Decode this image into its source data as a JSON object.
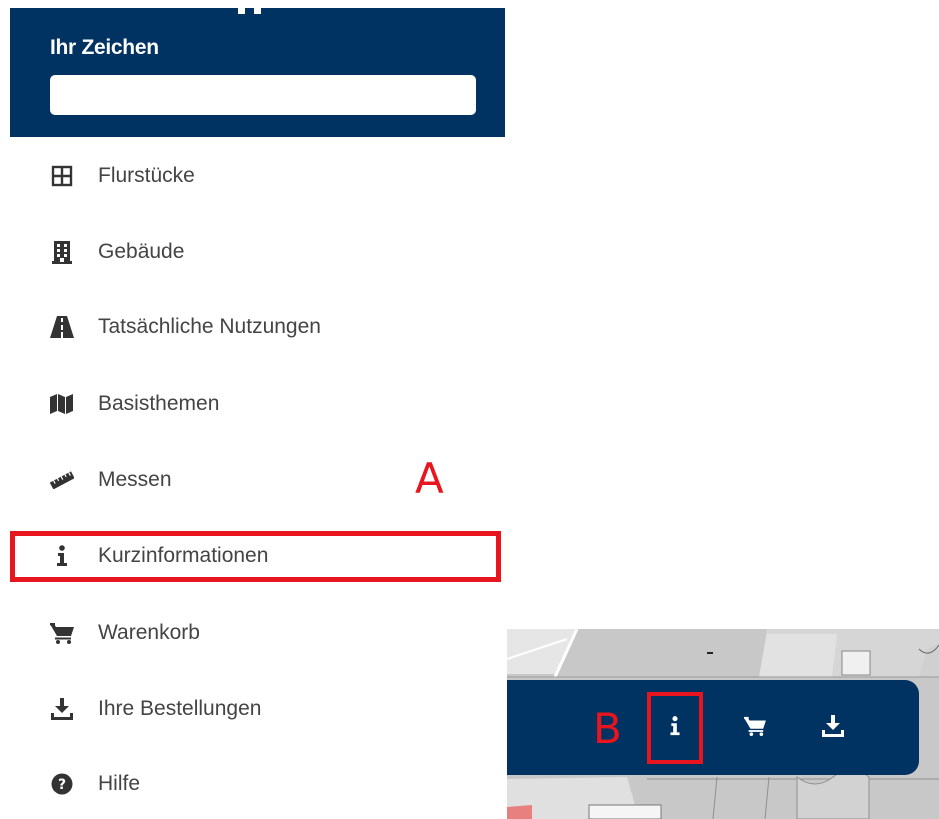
{
  "header": {
    "label": "Ihr Zeichen",
    "input_value": ""
  },
  "menu": {
    "items": [
      {
        "label": "Flurstücke",
        "icon": "grid-icon"
      },
      {
        "label": "Gebäude",
        "icon": "building-icon"
      },
      {
        "label": "Tatsächliche Nutzungen",
        "icon": "road-icon"
      },
      {
        "label": "Basisthemen",
        "icon": "map-icon"
      },
      {
        "label": "Messen",
        "icon": "ruler-icon"
      },
      {
        "label": "Kurzinformationen",
        "icon": "info-icon"
      },
      {
        "label": "Warenkorb",
        "icon": "cart-icon"
      },
      {
        "label": "Ihre Bestellungen",
        "icon": "download-icon"
      },
      {
        "label": "Hilfe",
        "icon": "question-circle-icon"
      }
    ]
  },
  "annotations": {
    "a": "A",
    "b": "B"
  },
  "toolbar": {
    "buttons": [
      {
        "icon": "info-icon"
      },
      {
        "icon": "cart-icon"
      },
      {
        "icon": "download-icon"
      }
    ]
  },
  "colors": {
    "navy": "#003361",
    "highlight": "#e8141e",
    "text": "#444444",
    "icon": "#333333"
  }
}
